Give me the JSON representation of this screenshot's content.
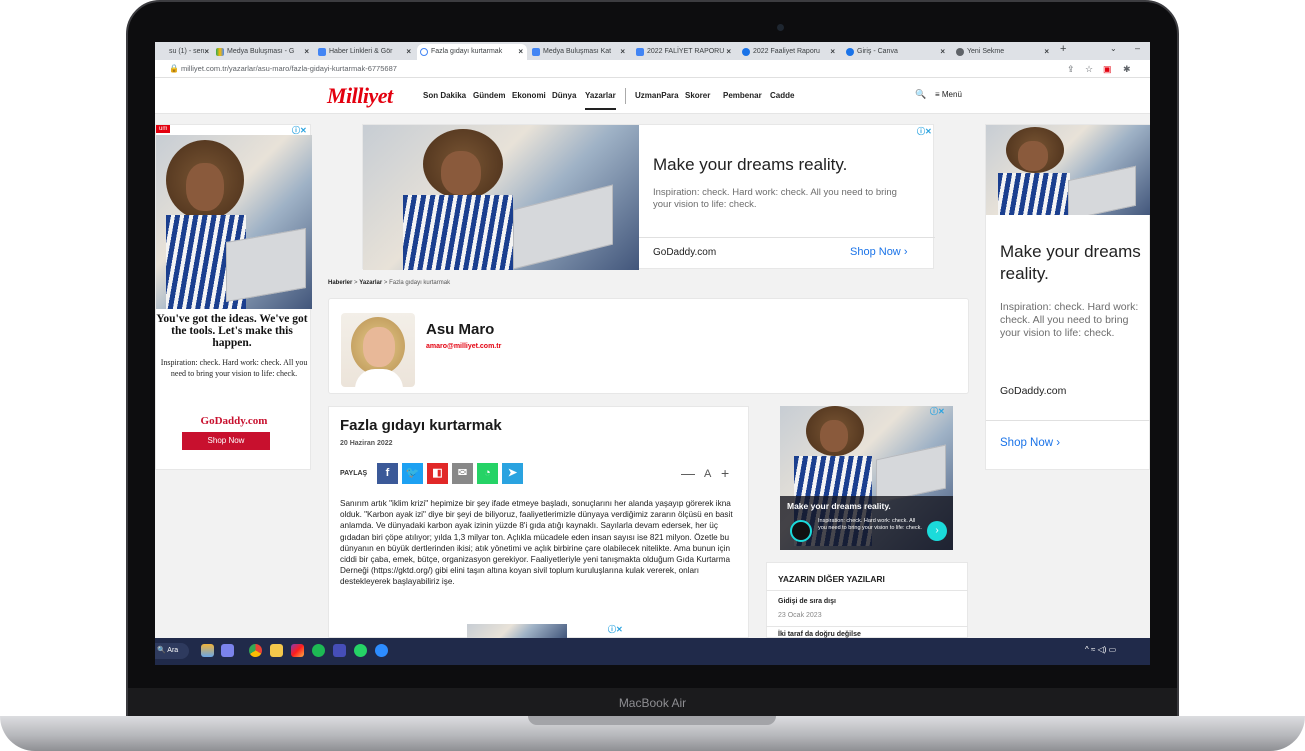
{
  "device_label": "MacBook Air",
  "browser": {
    "tabs": [
      {
        "label": "su (1) - sen",
        "active": false
      },
      {
        "label": "Medya Buluşması - G",
        "active": false
      },
      {
        "label": "Haber Linkleri & Gör",
        "active": false
      },
      {
        "label": "Fazla gıdayı kurtarmak",
        "active": true
      },
      {
        "label": "Medya Buluşması Kat",
        "active": false
      },
      {
        "label": "2022 FALİYET RAPORU",
        "active": false
      },
      {
        "label": "2022 Faaliyet Raporu",
        "active": false
      },
      {
        "label": "Giriş - Canva",
        "active": false
      },
      {
        "label": "Yeni Sekme",
        "active": false
      }
    ],
    "new_tab_symbol": "+",
    "url": "milliyet.com.tr/yazarlar/asu-maro/fazla-gidayi-kurtarmak-6775687"
  },
  "site": {
    "logo": "Milliyet",
    "nav": [
      "Son Dakika",
      "Gündem",
      "Ekonomi",
      "Dünya",
      "Yazarlar"
    ],
    "nav2": [
      "UzmanPara",
      "Skorer",
      "Pembenar",
      "Cadde"
    ],
    "menu_label": "Menü"
  },
  "ads": {
    "top": {
      "title": "Make your dreams reality.",
      "subtitle": "Inspiration: check. Hard work: check. All you need to bring your vision to life: check.",
      "domain": "GoDaddy.com",
      "button": "Shop Now"
    },
    "left": {
      "title": "You've got the ideas. We've got the tools. Let's make this happen.",
      "subtitle": "Inspiration: check. Hard work: check. All you need to bring your vision to life: check.",
      "brand": "GoDaddy.com",
      "button": "Shop Now",
      "corner": "um"
    },
    "right": {
      "title": "Make your dreams reality.",
      "subtitle": "Inspiration: check. Hard work: check. All you need to bring your vision to life: check.",
      "domain": "GoDaddy.com",
      "button": "Shop Now"
    },
    "side": {
      "title": "Make your dreams reality.",
      "subtitle": "Inspiration: check. Hard work: check. All you need to bring your vision to life: check."
    }
  },
  "breadcrumb": {
    "home": "Haberler",
    "section": "Yazarlar",
    "current": "Fazla gıdayı kurtarmak"
  },
  "author": {
    "name": "Asu Maro",
    "email": "amaro@milliyet.com.tr"
  },
  "article": {
    "title": "Fazla gıdayı kurtarmak",
    "date": "20 Haziran 2022",
    "share_label": "PAYLAŞ",
    "font_controls": [
      "—",
      "A",
      "+"
    ],
    "body": "Sanırım artık \"iklim krizi\" hepimize bir şey ifade etmeye başladı, sonuçlarını her alanda yaşayıp görerek ikna olduk. \"Karbon ayak izi\" diye bir şeyi de biliyoruz, faaliyetlerimizle dünyaya verdiğimiz zararın ölçüsü en basit anlamda. Ve dünyadaki karbon ayak izinin yüzde 8'i gıda atığı kaynaklı. Sayılarla devam edersek, her üç gıdadan biri çöpe atılıyor; yılda 1,3 milyar ton. Açlıkla mücadele eden insan sayısı ise 821 milyon. Özetle bu dünyanın en büyük dertlerinden ikisi; atık yönetimi ve açlık birbirine çare olabilecek nitelikte. Ama bunun için ciddi bir çaba, emek, bütçe, organizasyon gerekiyor. Faaliyetleriyle yeni tanışmakta olduğum Gıda Kurtarma Derneği (https://gktd.org/) gibi elini taşın altına koyan sivil toplum kuruluşlarına kulak vererek, onları destekleyerek başlayabiliriz işe."
  },
  "sidebar": {
    "heading": "YAZARIN DİĞER YAZILARI",
    "items": [
      {
        "title": "Gidişi de sıra dışı",
        "date": "23 Ocak 2023"
      },
      {
        "title": "İki taraf da doğru değilse",
        "date": ""
      }
    ]
  },
  "taskbar": {
    "search": "Ara",
    "status": "^ ≈ ◁) ▭"
  },
  "colors": {
    "brand_red": "#e3000f",
    "facebook": "#3b5998",
    "twitter": "#1da1f2",
    "flipboard": "#e12828",
    "mail": "#888888",
    "whatsapp": "#25d366",
    "telegram": "#2aa3e0"
  }
}
